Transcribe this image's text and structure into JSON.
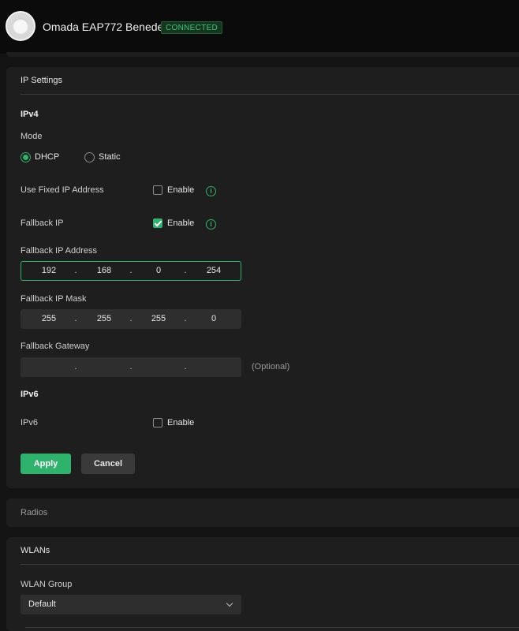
{
  "header": {
    "device_name": "Omada EAP772 Beneden",
    "status": "CONNECTED"
  },
  "ip_settings": {
    "title": "IP Settings",
    "ipv4": {
      "heading": "IPv4",
      "mode_label": "Mode",
      "mode_options": [
        "DHCP",
        "Static"
      ],
      "mode_selected": "DHCP",
      "fixed_ip": {
        "label": "Use Fixed IP Address",
        "checkbox_label": "Enable",
        "checked": false
      },
      "fallback_ip": {
        "label": "Fallback IP",
        "checkbox_label": "Enable",
        "checked": true
      },
      "fallback_ip_address": {
        "label": "Fallback IP Address",
        "octets": [
          "192",
          "168",
          "0",
          "254"
        ]
      },
      "fallback_ip_mask": {
        "label": "Fallback IP Mask",
        "octets": [
          "255",
          "255",
          "255",
          "0"
        ]
      },
      "fallback_gateway": {
        "label": "Fallback Gateway",
        "octets": [
          "",
          "",
          "",
          ""
        ],
        "hint": "(Optional)"
      }
    },
    "ipv6": {
      "heading": "IPv6",
      "label": "IPv6",
      "checkbox_label": "Enable",
      "checked": false
    },
    "buttons": {
      "apply": "Apply",
      "cancel": "Cancel"
    }
  },
  "radios": {
    "title": "Radios"
  },
  "wlans": {
    "title": "WLANs",
    "group_label": "WLAN Group",
    "group_value": "Default"
  },
  "colors": {
    "accent": "#2fb36c",
    "background": "#141414",
    "card": "#1e1e1e",
    "input": "#2e2e2e"
  }
}
